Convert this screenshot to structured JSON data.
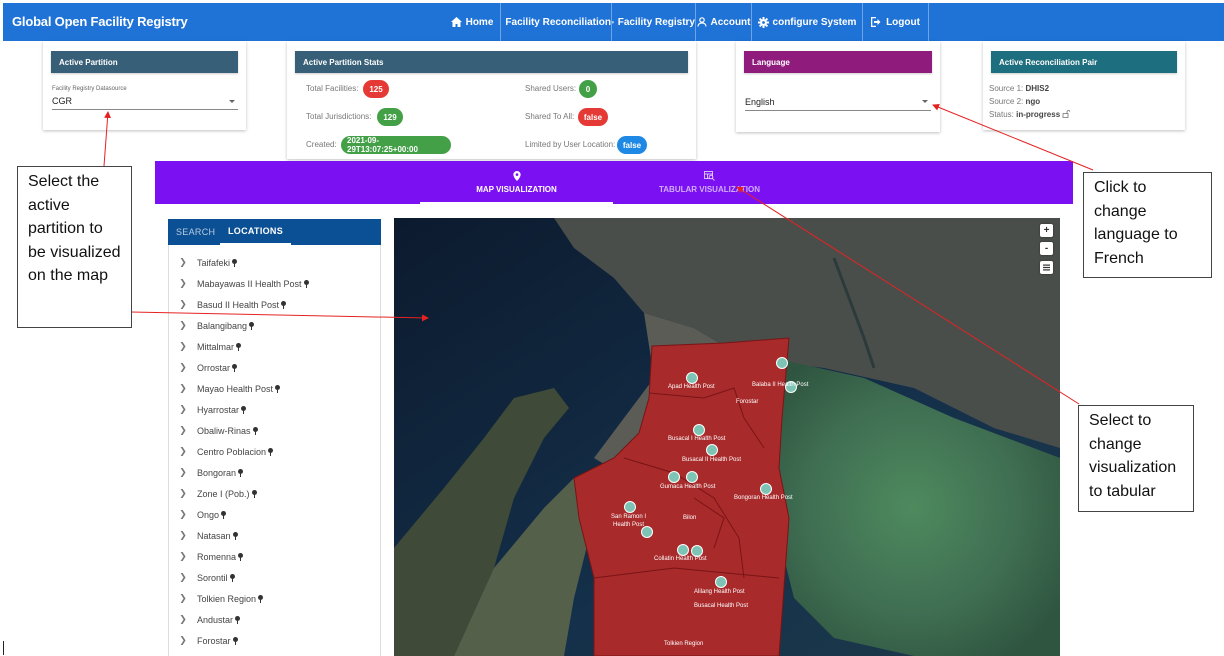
{
  "app": {
    "title": "Global Open Facility Registry"
  },
  "nav": {
    "home": "Home",
    "facility_reconciliation": "Facility Reconciliation",
    "facility_registry": "Facility Registry",
    "account": "Account",
    "configure_system": "configure System",
    "logout": "Logout"
  },
  "active_partition": {
    "header": "Active Partition",
    "datasource_label": "Facility Registry Datasource",
    "datasource_value": "CGR"
  },
  "stats": {
    "header": "Active Partition Stats",
    "total_facilities_label": "Total Facilities:",
    "total_facilities": "125",
    "total_jurisdictions_label": "Total Jurisdictions:",
    "total_jurisdictions": "129",
    "created_label": "Created:",
    "created": "2021-09-29T13:07:25+00:00",
    "shared_users_label": "Shared Users:",
    "shared_users": "0",
    "shared_to_all_label": "Shared To All:",
    "shared_to_all": "false",
    "limited_label": "Limited by User Location:",
    "limited": "false"
  },
  "language": {
    "header": "Language",
    "value": "English"
  },
  "recon_pair": {
    "header": "Active Reconciliation Pair",
    "source1_label": "Source 1:",
    "source1": "DHIS2",
    "source2_label": "Source 2:",
    "source2": "ngo",
    "status_label": "Status:",
    "status": "in-progress"
  },
  "viz_tabs": {
    "map": "MAP VISUALIZATION",
    "tabular": "TABULAR VISUALIZATION"
  },
  "left_panel": {
    "tabs": {
      "search": "SEARCH",
      "locations": "LOCATIONS"
    },
    "locations": [
      "Taifafeki",
      "Mabayawas II Health Post",
      "Basud II Health Post",
      "Balangibang",
      "Mittalmar",
      "Orrostar",
      "Mayao Health Post",
      "Hyarrostar",
      "Obaliw-Rinas",
      "Centro Poblacion",
      "Bongoran",
      "Zone I (Pob.)",
      "Ongo",
      "Natasan",
      "Romenna",
      "Sorontil",
      "Tolkien Region",
      "Andustar",
      "Forostar"
    ]
  },
  "map": {
    "zoom_in": "+",
    "zoom_out": "-",
    "labels": {
      "l1": "Apad Health Post",
      "l2": "Balaba II Health Post",
      "l3": "Forostar",
      "l4": "Busacal I Health Post",
      "l5": "Busacal II Health Post",
      "l6": "Gumaca Health Post",
      "l7": "Bongoran Health Post",
      "l8": "San Ramon I",
      "l9": "Health Post",
      "l10": "Bilon",
      "l11": "Collatin Health Post",
      "l12": "Alilang Health Post",
      "l13": "Busacal Health Post",
      "l14": "Tolkien Region"
    }
  },
  "callouts": {
    "partition": "Select the active partition to be visualized on the map",
    "language": "Click to change language to French",
    "tabular": "Select to change visualization to tabular"
  }
}
